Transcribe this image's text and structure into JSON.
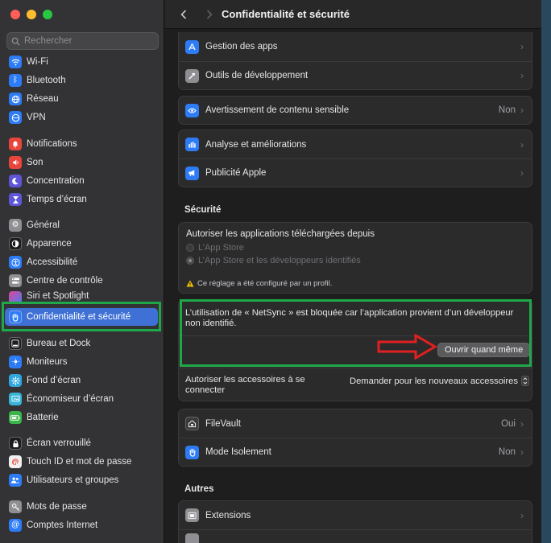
{
  "colors": {
    "accent": "#3e70d6",
    "highlight": "#1fa84a",
    "arrow": "#e02020"
  },
  "search": {
    "placeholder": "Rechercher"
  },
  "sidebar": {
    "items": [
      {
        "label": "Wi-Fi",
        "icon": "wifi-icon",
        "color": "#2d7cf6"
      },
      {
        "label": "Bluetooth",
        "icon": "bluetooth-icon",
        "color": "#2d7cf6"
      },
      {
        "label": "Réseau",
        "icon": "globe-icon",
        "color": "#2d7cf6"
      },
      {
        "label": "VPN",
        "icon": "vpn-icon",
        "color": "#2d7cf6"
      },
      {
        "label": "Notifications",
        "icon": "bell-icon",
        "color": "#e8453c"
      },
      {
        "label": "Son",
        "icon": "speaker-icon",
        "color": "#e8453c"
      },
      {
        "label": "Concentration",
        "icon": "moon-icon",
        "color": "#5e55d8"
      },
      {
        "label": "Temps d’écran",
        "icon": "hourglass-icon",
        "color": "#5e55d8"
      },
      {
        "label": "Général",
        "icon": "gear-icon",
        "color": "#8e8e93"
      },
      {
        "label": "Apparence",
        "icon": "appearance-icon",
        "color": "#1c1c1e"
      },
      {
        "label": "Accessibilité",
        "icon": "accessibility-icon",
        "color": "#2d7cf6"
      },
      {
        "label": "Centre de contrôle",
        "icon": "control-center-icon",
        "color": "#8e8e93"
      },
      {
        "label": "Siri et Spotlight",
        "icon": "siri-icon",
        "color": "#b14bd6"
      },
      {
        "label": "Confidentialité et sécurité",
        "icon": "hand-icon",
        "color": "#2d7cf6"
      },
      {
        "label": "Bureau et Dock",
        "icon": "dock-icon",
        "color": "#1c1c1e"
      },
      {
        "label": "Moniteurs",
        "icon": "display-icon",
        "color": "#2d7cf6"
      },
      {
        "label": "Fond d’écran",
        "icon": "wallpaper-icon",
        "color": "#2fa6e0"
      },
      {
        "label": "Économiseur d’écran",
        "icon": "screensaver-icon",
        "color": "#38b5d8"
      },
      {
        "label": "Batterie",
        "icon": "battery-icon",
        "color": "#3bb54a"
      },
      {
        "label": "Écran verrouillé",
        "icon": "lock-icon",
        "color": "#1c1c1e"
      },
      {
        "label": "Touch ID et mot de passe",
        "icon": "fingerprint-icon",
        "color": "#f0f0f0"
      },
      {
        "label": "Utilisateurs et groupes",
        "icon": "users-icon",
        "color": "#2d7cf6"
      },
      {
        "label": "Mots de passe",
        "icon": "key-icon",
        "color": "#8e8e93"
      },
      {
        "label": "Comptes Internet",
        "icon": "at-icon",
        "color": "#2d7cf6"
      }
    ]
  },
  "header": {
    "title": "Confidentialité et sécurité"
  },
  "main": {
    "row_gestion": "Gestion des apps",
    "row_outils": "Outils de développement",
    "row_avert": "Avertissement de contenu sensible",
    "row_avert_value": "Non",
    "row_analyse": "Analyse et améliorations",
    "row_pub": "Publicité Apple",
    "security_title": "Sécurité",
    "allow_title": "Autoriser les applications téléchargées depuis",
    "option_appstore": "L’App Store",
    "option_appstore_dev": "L’App Store et les développeurs identifiés",
    "profile_note": "Ce réglage a été configuré par un profil.",
    "blocked_message": "L’utilisation de « NetSync » est bloquée car l’application provient d’un développeur non identifié.",
    "open_anyway": "Ouvrir quand même",
    "accessories_label": "Autoriser les accessoires à se connecter",
    "accessories_value": "Demander pour les nouveaux accessoires",
    "filevault": "FileVault",
    "filevault_value": "Oui",
    "lockdown": "Mode Isolement",
    "lockdown_value": "Non",
    "others_title": "Autres",
    "extensions": "Extensions"
  }
}
